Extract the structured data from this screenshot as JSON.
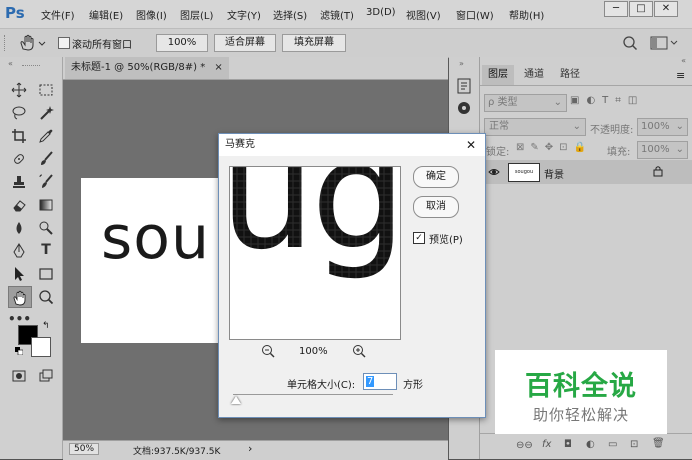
{
  "app": {
    "logo": "Ps"
  },
  "menu": [
    "文件(F)",
    "编辑(E)",
    "图像(I)",
    "图层(L)",
    "文字(Y)",
    "选择(S)",
    "滤镜(T)",
    "3D(D)",
    "视图(V)",
    "窗口(W)",
    "帮助(H)"
  ],
  "window_controls": {
    "minimize": "─",
    "maximize": "□",
    "close": "✕"
  },
  "options_bar": {
    "scroll_all_label": "滚动所有窗口",
    "scroll_all_checked": false,
    "zoom_100": "100%",
    "fit_screen": "适合屏幕",
    "fill_screen": "填充屏幕"
  },
  "document": {
    "tab_title": "未标题-1 @ 50%(RGB/8#) *",
    "close": "×",
    "canvas_text": "sou",
    "zoom": "50%",
    "doc_info": "文档:937.5K/937.5K",
    "arrow": "›"
  },
  "layers_panel": {
    "tabs": [
      "图层",
      "通道",
      "路径"
    ],
    "filter_label": "ρ 类型",
    "blend_mode": "正常",
    "opacity_label": "不透明度:",
    "opacity_value": "100%",
    "lock_label": "锁定:",
    "fill_label": "填充:",
    "fill_value": "100%",
    "layers": [
      {
        "name": "背景",
        "thumb_text": "sougou"
      }
    ]
  },
  "dialog": {
    "title": "马赛克",
    "close": "✕",
    "preview_text": "ug",
    "ok": "确定",
    "cancel": "取消",
    "preview_label": "预览(P)",
    "preview_checked": true,
    "zoom_level": "100%",
    "cell_size_label": "单元格大小(C):",
    "cell_size_value": "7",
    "unit": "方形"
  },
  "watermark": {
    "title": "百科全说",
    "subtitle": "助你轻松解决"
  },
  "colors": {
    "accent": "#2c6bb0",
    "watermark_green": "#27a845",
    "selection_blue": "#3399ff"
  }
}
